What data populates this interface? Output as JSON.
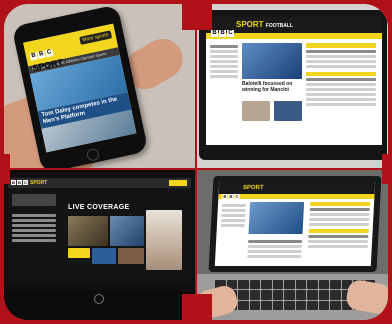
{
  "phone": {
    "brand": [
      "B",
      "B",
      "C"
    ],
    "sport": "SPORT",
    "sub": "OLYMPICS",
    "button": "More sports",
    "nav": "Schedule & results  Athletes  Olympic sports",
    "headline": "Tom Daley competes in the Men's Platform"
  },
  "laptop": {
    "brand": [
      "B",
      "B",
      "C"
    ],
    "sport": "SPORT",
    "section": "FOOTBALL",
    "headline": "Balotelli focussed on winning for Mancini"
  },
  "tv": {
    "brand": [
      "B",
      "B",
      "C"
    ],
    "sport": "SPORT",
    "heading": "LIVE COVERAGE"
  },
  "laptop2": {
    "brand": [
      "B",
      "B",
      "C"
    ],
    "sport": "SPORT"
  },
  "colors": {
    "frame": "#b1121a",
    "bbc_yellow": "#f2d51d"
  }
}
